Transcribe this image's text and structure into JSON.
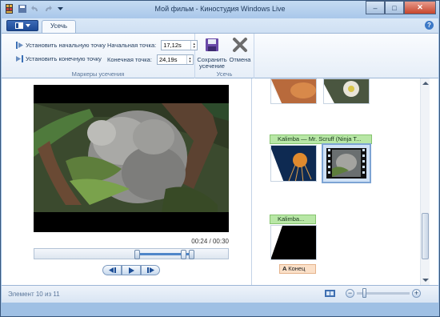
{
  "window": {
    "title": "Мой фильм - Киностудия Windows Live",
    "min_label": "–",
    "max_label": "□",
    "close_label": "✕"
  },
  "ribbon": {
    "tab_active": "Усечь",
    "help_label": "?",
    "trim_markers": {
      "set_start_label": "Установить начальную точку",
      "set_end_label": "Установить конечную точку",
      "start_field_label": "Начальная точка:",
      "start_value": "17,12s",
      "end_field_label": "Конечная точка:",
      "end_value": "24,19s",
      "group_label": "Маркеры усечения"
    },
    "trim": {
      "save_label": "Сохранить усечение",
      "cancel_label": "Отмена",
      "group_label": "Усечь"
    }
  },
  "preview": {
    "time_readout": "00:24 / 00:30"
  },
  "storyboard": {
    "audio_caption": "Kalimba — Mr. Scruff (Ninja T...",
    "audio_caption_2": "Kalimba...",
    "end_caption": "Конец"
  },
  "status": {
    "item_count": "Элемент 10 из 11"
  },
  "colors": {
    "accent": "#4f86c9",
    "audio": "#b8e7a6",
    "caption": "#fbe0c8"
  }
}
